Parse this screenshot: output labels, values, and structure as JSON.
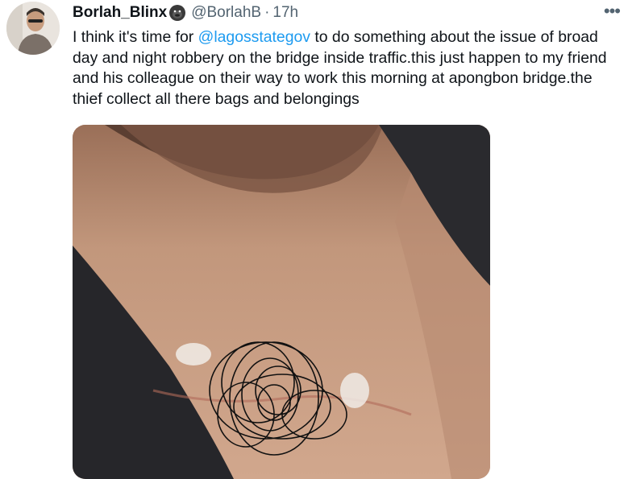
{
  "tweet": {
    "author": {
      "display_name": "Borlah_Blinx",
      "name_emoji_icon": "gorilla-icon",
      "handle": "@BorlahB",
      "separator": "·",
      "timestamp": "17h"
    },
    "more_icon": "more-horizontal-icon",
    "more_label": "•••",
    "text_before_mention": "I think it's time for ",
    "mention": "@lagosstategov",
    "text_after_mention": " to do something about the issue of broad day and night robbery on the bridge inside traffic.this just happen to my friend and his colleague on their way to work this morning at apongbon bridge.the thief collect all there bags and belongings",
    "colors": {
      "text": "#0f1419",
      "secondary": "#536471",
      "link": "#1d9bf0"
    }
  }
}
